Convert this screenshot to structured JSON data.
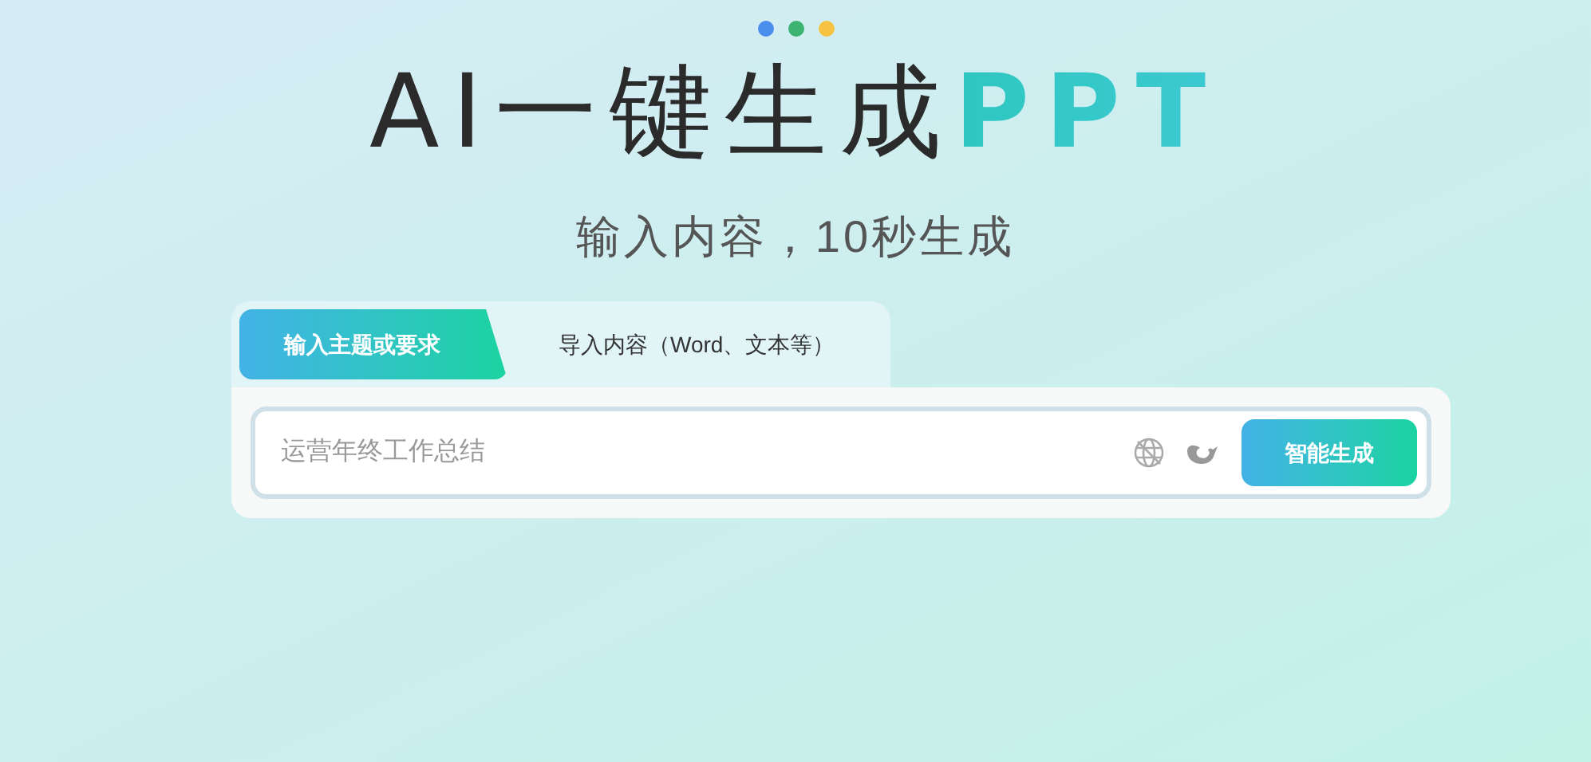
{
  "dots": [
    {
      "color": "#4a8fec"
    },
    {
      "color": "#3cb371"
    },
    {
      "color": "#f5c242"
    }
  ],
  "title": {
    "main": "AI一键生成",
    "highlight": "PPT"
  },
  "subtitle": "输入内容，10秒生成",
  "tabs": [
    {
      "label": "输入主题或要求",
      "selected": true
    },
    {
      "label": "导入内容（Word、文本等）",
      "selected": false
    }
  ],
  "input": {
    "placeholder": "运营年终工作总结"
  },
  "generate_button": "智能生成"
}
